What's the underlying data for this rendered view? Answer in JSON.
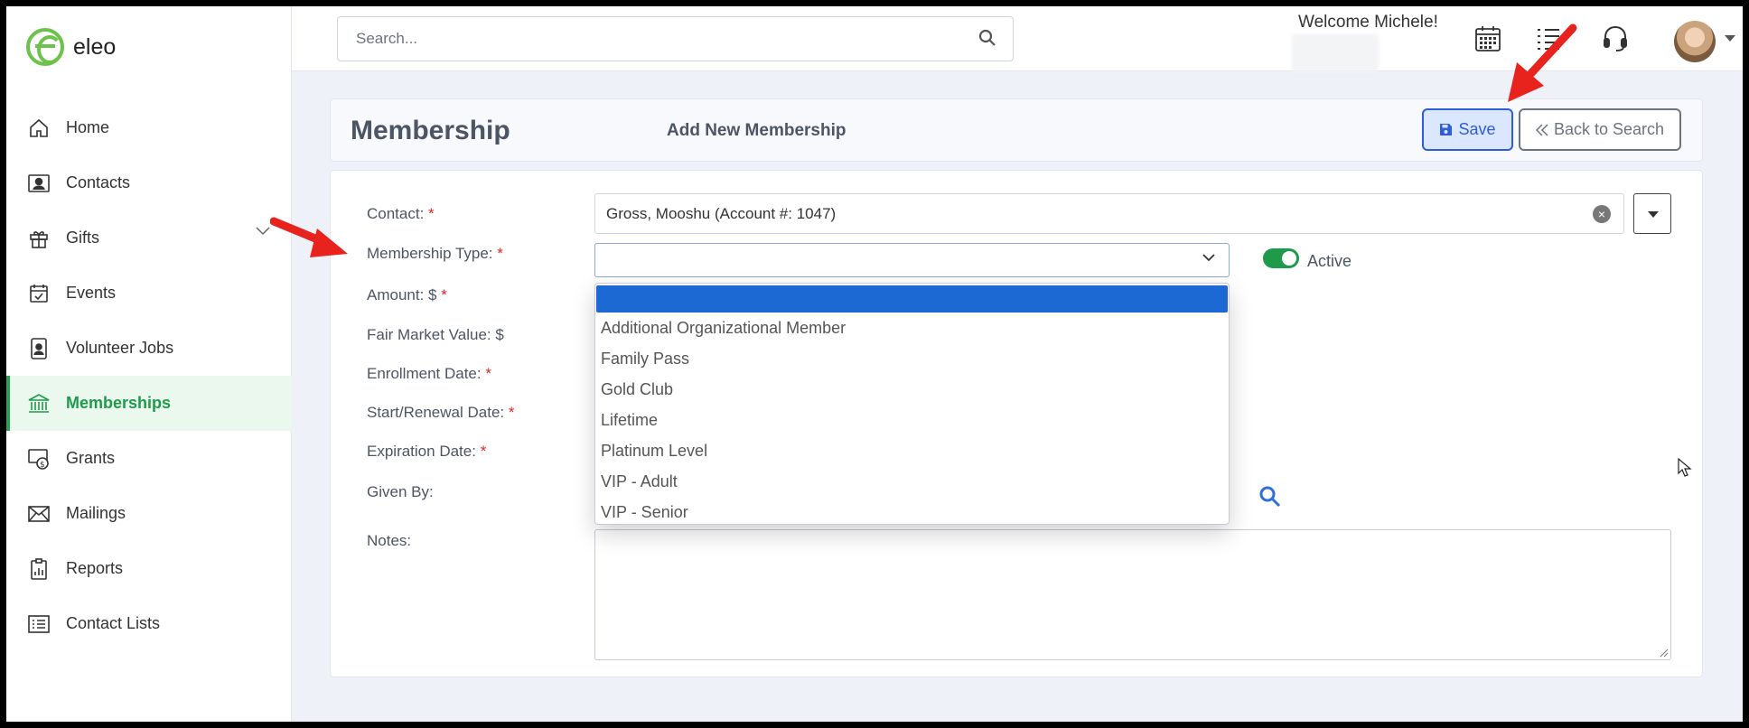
{
  "app": {
    "name": "eleo"
  },
  "sidebar": {
    "items": [
      {
        "label": "Home",
        "icon": "home-icon",
        "active": false
      },
      {
        "label": "Contacts",
        "icon": "contact-card-icon",
        "active": false
      },
      {
        "label": "Gifts",
        "icon": "gift-icon",
        "active": false,
        "expandable": true
      },
      {
        "label": "Events",
        "icon": "calendar-check-icon",
        "active": false
      },
      {
        "label": "Volunteer Jobs",
        "icon": "id-badge-icon",
        "active": false
      },
      {
        "label": "Memberships",
        "icon": "bank-icon",
        "active": true
      },
      {
        "label": "Grants",
        "icon": "money-bag-icon",
        "active": false
      },
      {
        "label": "Mailings",
        "icon": "envelope-icon",
        "active": false
      },
      {
        "label": "Reports",
        "icon": "clipboard-chart-icon",
        "active": false
      },
      {
        "label": "Contact Lists",
        "icon": "list-icon",
        "active": false
      }
    ]
  },
  "topbar": {
    "search_placeholder": "Search...",
    "welcome": "Welcome Michele!",
    "icons": [
      "calendar-grid-icon",
      "task-list-icon",
      "headset-icon",
      "user-avatar"
    ]
  },
  "header": {
    "title": "Membership",
    "subtitle": "Add New Membership",
    "save_label": "Save",
    "back_label": "Back to Search"
  },
  "form": {
    "contact_label": "Contact:",
    "contact_value": "Gross, Mooshu (Account #: 1047)",
    "membership_type_label": "Membership Type:",
    "amount_label": "Amount: $",
    "fmv_label": "Fair Market Value: $",
    "enrollment_label": "Enrollment Date:",
    "start_label": "Start/Renewal Date:",
    "expiration_label": "Expiration Date:",
    "given_by_label": "Given By:",
    "notes_label": "Notes:",
    "required_mark": "*",
    "active_label": "Active",
    "active_on": true
  },
  "membership_type_options": [
    "",
    "Additional Organizational Member",
    "Family Pass",
    "Gold Club",
    "Lifetime",
    "Platinum Level",
    "VIP - Adult",
    "VIP - Senior"
  ],
  "colors": {
    "accent_green": "#1f9a4b",
    "primary_blue": "#2f5dd8",
    "selected_option": "#1c69d4",
    "annotation_arrow": "#e8231e"
  }
}
